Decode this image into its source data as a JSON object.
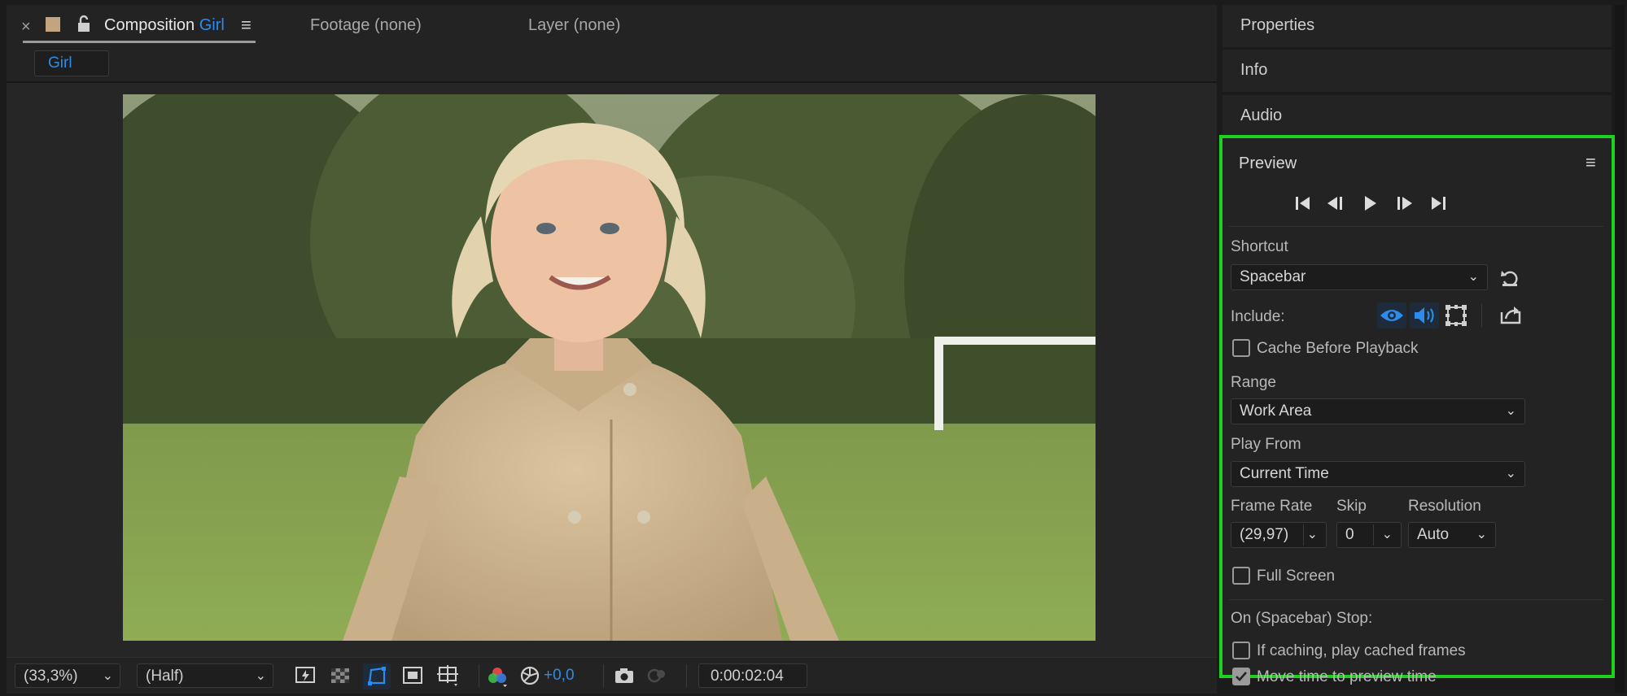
{
  "composition_panel": {
    "tab_composition_prefix": "Composition",
    "tab_composition_name": "Girl",
    "tab_footage": "Footage (none)",
    "tab_layer": "Layer (none)",
    "breadcrumb": "Girl"
  },
  "viewer_toolbar": {
    "magnification": "(33,3%)",
    "resolution": "(Half)",
    "exposure": "+0,0",
    "timecode": "0:00:02:04"
  },
  "right_panels": {
    "properties": "Properties",
    "info": "Info",
    "audio": "Audio"
  },
  "preview": {
    "title": "Preview",
    "shortcut_label": "Shortcut",
    "shortcut_value": "Spacebar",
    "include_label": "Include:",
    "cache_before_playback": "Cache Before Playback",
    "range_label": "Range",
    "range_value": "Work Area",
    "play_from_label": "Play From",
    "play_from_value": "Current Time",
    "frame_rate_label": "Frame Rate",
    "frame_rate_value": "(29,97)",
    "skip_label": "Skip",
    "skip_value": "0",
    "resolution_label": "Resolution",
    "resolution_value": "Auto",
    "full_screen": "Full Screen",
    "on_stop_label": "On (Spacebar) Stop:",
    "if_caching": "If caching, play cached frames",
    "move_time": "Move time to preview time",
    "checkbox_states": {
      "cache_before_playback": false,
      "full_screen": false,
      "if_caching": false,
      "move_time": true
    }
  },
  "colors": {
    "accent_blue": "#2d8ceb",
    "highlight_green": "#1fd11f"
  }
}
